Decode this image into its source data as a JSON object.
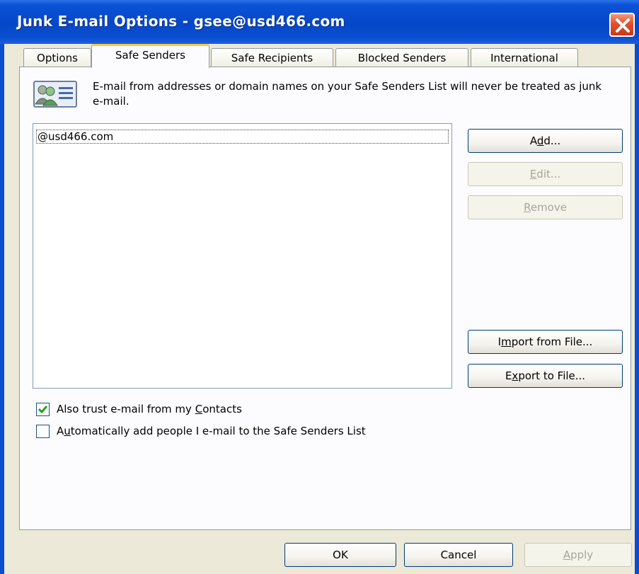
{
  "window": {
    "title": "Junk E-mail Options - gsee@usd466.com"
  },
  "tabs": [
    {
      "label": "Options",
      "active": false
    },
    {
      "label": "Safe Senders",
      "active": true
    },
    {
      "label": "Safe Recipients",
      "active": false
    },
    {
      "label": "Blocked Senders",
      "active": false
    },
    {
      "label": "International",
      "active": false
    }
  ],
  "info": {
    "text": "E-mail from addresses or domain names on your Safe Senders List will never be treated as junk e-mail.",
    "icon": "contacts-icon"
  },
  "safe_senders_list": {
    "items": [
      "@usd466.com"
    ]
  },
  "side_buttons": {
    "add": {
      "pre": "A",
      "key": "d",
      "post": "d...",
      "enabled": true
    },
    "edit": {
      "pre": "",
      "key": "E",
      "post": "dit...",
      "enabled": false
    },
    "remove": {
      "pre": "",
      "key": "R",
      "post": "emove",
      "enabled": false
    },
    "import": {
      "pre": "I",
      "key": "m",
      "post": "port from File...",
      "enabled": true
    },
    "export": {
      "pre": "E",
      "key": "x",
      "post": "port to File...",
      "enabled": true
    }
  },
  "options": {
    "trust_contacts": {
      "pre": "Also trust e-mail from my ",
      "key": "C",
      "post": "ontacts",
      "checked": true
    },
    "auto_add": {
      "pre": "A",
      "key": "u",
      "post": "tomatically add people I e-mail to the Safe Senders List",
      "checked": false
    }
  },
  "footer": {
    "ok": "OK",
    "cancel": "Cancel",
    "apply_key": "A",
    "apply_post": "pply"
  },
  "colors": {
    "titlebar": "#0a4ed0",
    "dialog_bg": "#ece9d8",
    "tab_highlight": "#ffc73c",
    "check_green": "#21a121"
  }
}
